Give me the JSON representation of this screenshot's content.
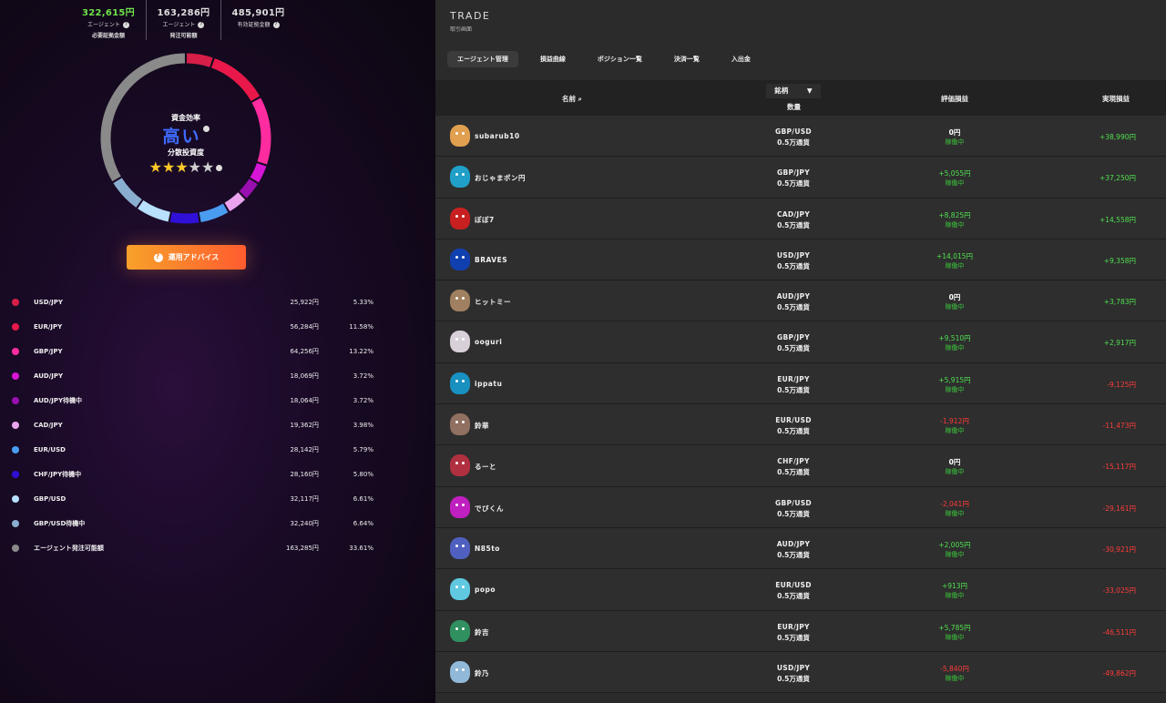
{
  "stats": [
    {
      "value": "322,615円",
      "label": "エージェント",
      "label2": "必要証拠金額",
      "color": "#6fe34a"
    },
    {
      "value": "163,286円",
      "label": "エージェント",
      "label2": "発注可能額",
      "color": "#dddddd"
    },
    {
      "value": "485,901円",
      "label": "有効証拠金額",
      "label2": "",
      "color": "#dddddd"
    }
  ],
  "efficiency": {
    "label": "資金効率",
    "value": "高い",
    "diversity_label": "分散投資度",
    "rating": 3,
    "rating_max": 5
  },
  "advice_button": "運用アドバイス",
  "allocation": [
    {
      "name": "USD/JPY",
      "amount": "25,922円",
      "pct": "5.33%",
      "fraction": 0.0533,
      "color": "#d61e48"
    },
    {
      "name": "EUR/JPY",
      "amount": "56,284円",
      "pct": "11.58%",
      "fraction": 0.1158,
      "color": "#e8194a"
    },
    {
      "name": "GBP/JPY",
      "amount": "64,256円",
      "pct": "13.22%",
      "fraction": 0.1322,
      "color": "#ff2ca0"
    },
    {
      "name": "AUD/JPY",
      "amount": "18,069円",
      "pct": "3.72%",
      "fraction": 0.0372,
      "color": "#d615d6"
    },
    {
      "name": "AUD/JPY待機中",
      "amount": "18,064円",
      "pct": "3.72%",
      "fraction": 0.0372,
      "color": "#9a0fb0"
    },
    {
      "name": "CAD/JPY",
      "amount": "19,362円",
      "pct": "3.98%",
      "fraction": 0.0398,
      "color": "#eaa4ee"
    },
    {
      "name": "EUR/USD",
      "amount": "28,142円",
      "pct": "5.79%",
      "fraction": 0.0579,
      "color": "#4a9cf0"
    },
    {
      "name": "CHF/JPY待機中",
      "amount": "28,160円",
      "pct": "5.80%",
      "fraction": 0.058,
      "color": "#3010d8"
    },
    {
      "name": "GBP/USD",
      "amount": "32,117円",
      "pct": "6.61%",
      "fraction": 0.0661,
      "color": "#b8e0ff"
    },
    {
      "name": "GBP/USD待機中",
      "amount": "32,240円",
      "pct": "6.64%",
      "fraction": 0.0664,
      "color": "#8aaed0"
    },
    {
      "name": "エージェント発注可能額",
      "amount": "163,285円",
      "pct": "33.61%",
      "fraction": 0.3361,
      "color": "#8a8a8a"
    }
  ],
  "trade": {
    "title": "TRADE",
    "subtitle": "取引画面",
    "tabs": [
      "エージェント管理",
      "損益曲線",
      "ポジション一覧",
      "決済一覧",
      "入出金"
    ],
    "headers": {
      "name": "名前",
      "pair": "銘柄",
      "qty": "数量",
      "eval": "評価損益",
      "realized": "実現損益"
    },
    "rows": [
      {
        "name": "subarub10",
        "pair": "GBP/USD",
        "qty": "0.5万通貨",
        "eval": "0円",
        "eval_sign": "zero",
        "status": "稼働中",
        "realized": "+38,990円",
        "real_sign": "pos",
        "avatar": "#e0a050"
      },
      {
        "name": "おじゃまポン円",
        "pair": "GBP/JPY",
        "qty": "0.5万通貨",
        "eval": "+5,055円",
        "eval_sign": "pos",
        "status": "稼働中",
        "realized": "+37,250円",
        "real_sign": "pos",
        "avatar": "#20a0c8"
      },
      {
        "name": "ぽぽ7",
        "pair": "CAD/JPY",
        "qty": "0.5万通貨",
        "eval": "+8,825円",
        "eval_sign": "pos",
        "status": "稼働中",
        "realized": "+14,558円",
        "real_sign": "pos",
        "avatar": "#c82020"
      },
      {
        "name": "BRAVES",
        "pair": "USD/JPY",
        "qty": "0.5万通貨",
        "eval": "+14,015円",
        "eval_sign": "pos",
        "status": "稼働中",
        "realized": "+9,358円",
        "real_sign": "pos",
        "avatar": "#1040b0"
      },
      {
        "name": "ヒットミー",
        "pair": "AUD/JPY",
        "qty": "0.5万通貨",
        "eval": "0円",
        "eval_sign": "zero",
        "status": "稼働中",
        "realized": "+3,783円",
        "real_sign": "pos",
        "avatar": "#a08060"
      },
      {
        "name": "ooguri",
        "pair": "GBP/JPY",
        "qty": "0.5万通貨",
        "eval": "+9,510円",
        "eval_sign": "pos",
        "status": "稼働中",
        "realized": "+2,917円",
        "real_sign": "pos",
        "avatar": "#d8d0d8"
      },
      {
        "name": "ippatu",
        "pair": "EUR/JPY",
        "qty": "0.5万通貨",
        "eval": "+5,915円",
        "eval_sign": "pos",
        "status": "稼働中",
        "realized": "-9,125円",
        "real_sign": "neg",
        "avatar": "#1890c0"
      },
      {
        "name": "鈴華",
        "pair": "EUR/USD",
        "qty": "0.5万通貨",
        "eval": "-1,912円",
        "eval_sign": "neg",
        "status": "稼働中",
        "realized": "-11,473円",
        "real_sign": "neg",
        "avatar": "#907060"
      },
      {
        "name": "るーと",
        "pair": "CHF/JPY",
        "qty": "0.5万通貨",
        "eval": "0円",
        "eval_sign": "zero",
        "status": "稼働中",
        "realized": "-15,117円",
        "real_sign": "neg",
        "avatar": "#b03040"
      },
      {
        "name": "でびくん",
        "pair": "GBP/USD",
        "qty": "0.5万通貨",
        "eval": "-2,041円",
        "eval_sign": "neg",
        "status": "稼働中",
        "realized": "-29,161円",
        "real_sign": "neg",
        "avatar": "#c020c0"
      },
      {
        "name": "N85to",
        "pair": "AUD/JPY",
        "qty": "0.5万通貨",
        "eval": "+2,005円",
        "eval_sign": "pos",
        "status": "稼働中",
        "realized": "-30,921円",
        "real_sign": "neg",
        "avatar": "#5060c0"
      },
      {
        "name": "popo",
        "pair": "EUR/USD",
        "qty": "0.5万通貨",
        "eval": "+913円",
        "eval_sign": "pos",
        "status": "稼働中",
        "realized": "-33,025円",
        "real_sign": "neg",
        "avatar": "#60c8e0"
      },
      {
        "name": "鈴吉",
        "pair": "EUR/JPY",
        "qty": "0.5万通貨",
        "eval": "+5,785円",
        "eval_sign": "pos",
        "status": "稼働中",
        "realized": "-46,511円",
        "real_sign": "neg",
        "avatar": "#309060"
      },
      {
        "name": "鈴乃",
        "pair": "USD/JPY",
        "qty": "0.5万通貨",
        "eval": "-5,840円",
        "eval_sign": "neg",
        "status": "稼働中",
        "realized": "-49,862円",
        "real_sign": "neg",
        "avatar": "#90b8d8"
      }
    ]
  }
}
